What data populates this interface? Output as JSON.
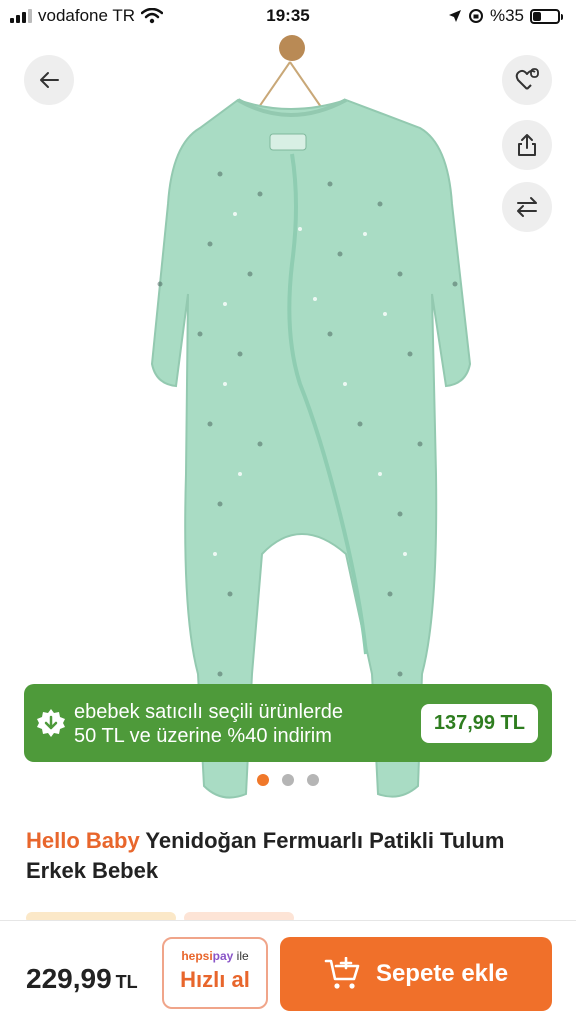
{
  "status_bar": {
    "carrier": "vodafone TR",
    "time": "19:35",
    "battery": "%35",
    "battery_level": 0.35
  },
  "gallery": {
    "image_alt": "Mint green baby sleepsuit with zipper on wooden hanger",
    "dots_count": 3,
    "active_dot": 0
  },
  "promo": {
    "line1": "ebebek satıcılı seçili ürünlerde",
    "line2": "50 TL ve üzerine %40 indirim",
    "price": "137,99 TL"
  },
  "product": {
    "brand": "Hello Baby",
    "title": " Yenidoğan Fermuarlı Patikli Tulum Erkek Bebek"
  },
  "bottom_bar": {
    "price": "229,99",
    "currency": "TL",
    "hepsipay_part1": "hepsi",
    "hepsipay_part2": "pay",
    "hepsipay_suffix": " ile",
    "quick_buy_label": "Hızlı al",
    "add_to_cart_label": "Sepete ekle"
  },
  "colors": {
    "accent_orange": "#f0702a",
    "promo_green": "#4e9a3a",
    "garment_mint": "#a9dcc4"
  },
  "icons": [
    "back-arrow-icon",
    "heart-bell-icon",
    "share-icon",
    "compare-arrows-icon",
    "discount-badge-icon",
    "cart-plus-icon"
  ]
}
